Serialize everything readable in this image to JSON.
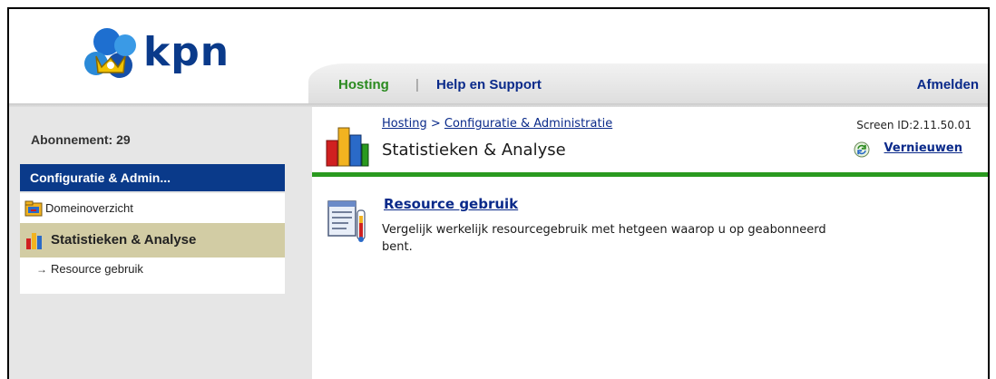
{
  "header": {
    "logo_text": "kpn",
    "nav": {
      "hosting": "Hosting",
      "separator": "|",
      "help": "Help en Support",
      "logout": "Afmelden"
    }
  },
  "sidebar": {
    "subscription_label": "Abonnement: 29",
    "section_title": "Configuratie & Admin...",
    "items": [
      {
        "label": "Domeinoverzicht",
        "icon": "domain-folder-icon"
      },
      {
        "label": "Statistieken & Analyse",
        "icon": "bar-chart-icon",
        "selected": true
      },
      {
        "label": "Resource gebruik",
        "icon": "arrow-right-icon"
      }
    ]
  },
  "main": {
    "breadcrumb": {
      "hosting": "Hosting",
      "separator": ">",
      "config": "Configuratie & Administratie"
    },
    "title": "Statistieken & Analyse",
    "screen_id": "Screen ID:2.11.50.01",
    "refresh_label": "Vernieuwen",
    "resource_link": "Resource gebruik",
    "resource_description": "Vergelijk werkelijk resourcegebruik met hetgeen waarop u op geabonneerd bent."
  },
  "colors": {
    "brand_blue": "#0a3a8a",
    "hosting_green": "#2a8a1f",
    "accent_bar": "#2a9a1f",
    "selected_item_bg": "#d2cca4"
  }
}
